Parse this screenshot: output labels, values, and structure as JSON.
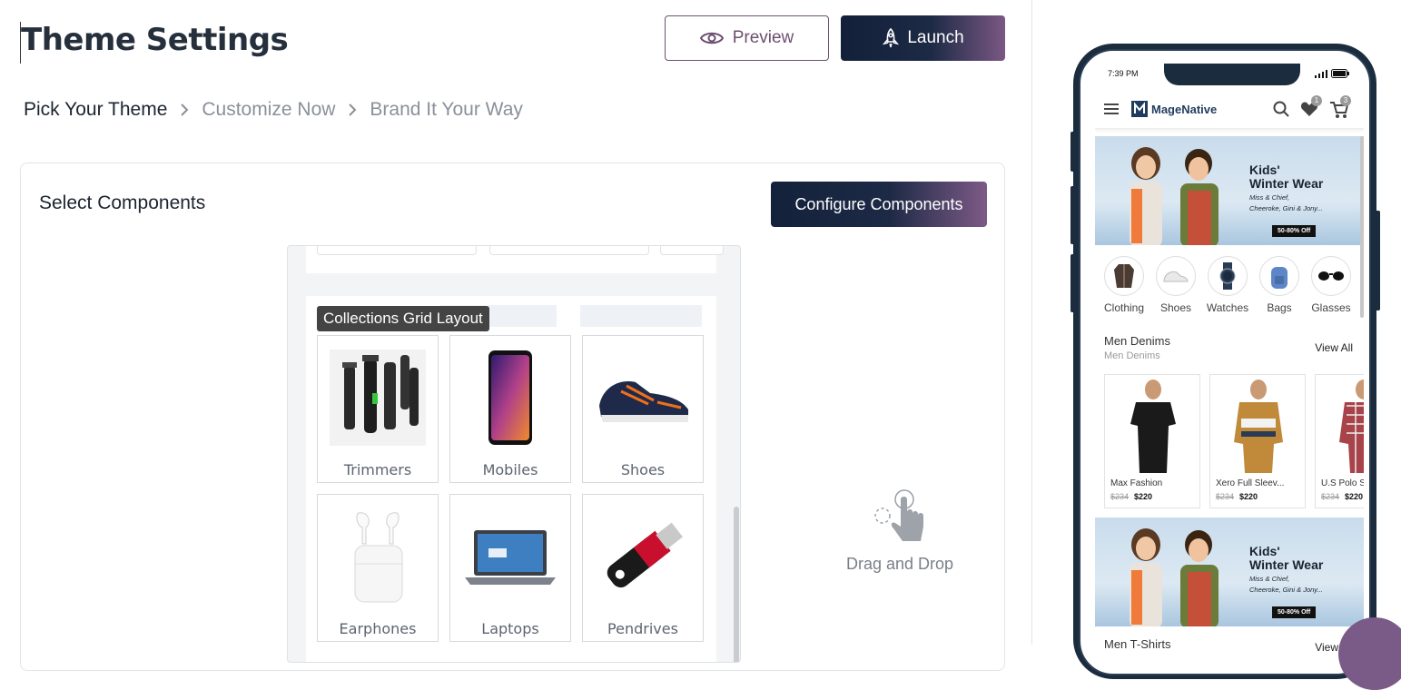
{
  "page": {
    "title": "Theme Settings",
    "preview_label": "Preview",
    "launch_label": "Launch"
  },
  "breadcrumb": {
    "steps": [
      "Pick Your Theme",
      "Customize Now",
      "Brand It Your Way"
    ]
  },
  "components": {
    "title": "Select Components",
    "configure_label": "Configure Components",
    "layout_tag": "Collections Grid Layout",
    "drag_label": "Drag and Drop",
    "tiles": [
      {
        "label": "Trimmers",
        "icon": "trimmer-image"
      },
      {
        "label": "Mobiles",
        "icon": "mobile-image"
      },
      {
        "label": "Shoes",
        "icon": "shoe-image"
      },
      {
        "label": "Earphones",
        "icon": "earphones-image"
      },
      {
        "label": "Laptops",
        "icon": "laptop-image"
      },
      {
        "label": "Pendrives",
        "icon": "pendrive-image"
      }
    ]
  },
  "phone": {
    "time": "7:39 PM",
    "brand": "MageNative",
    "wishlist_count": "1",
    "cart_count": "3",
    "banner": {
      "heading_line1": "Kids'",
      "heading_line2": "Winter Wear",
      "sub_line1": "Miss & Chief,",
      "sub_line2": "Cheeroke, Gini & Jony...",
      "offer": "50-80% Off"
    },
    "categories": [
      "Clothing",
      "Shoes",
      "Watches",
      "Bags",
      "Glasses"
    ],
    "section1": {
      "title": "Men Denims",
      "subtitle": "Men Denims",
      "view_all": "View All"
    },
    "products": [
      {
        "name": "Max Fashion",
        "old_price": "$234",
        "price": "$220"
      },
      {
        "name": "Xero Full Sleev...",
        "old_price": "$234",
        "price": "$220"
      },
      {
        "name": "U.S Polo S",
        "old_price": "$234",
        "price": "$220"
      }
    ],
    "section2": {
      "title": "Men T-Shirts",
      "view_all": "View All"
    }
  },
  "colors": {
    "primary_dark": "#14213b",
    "accent_purple": "#7d5a86"
  }
}
